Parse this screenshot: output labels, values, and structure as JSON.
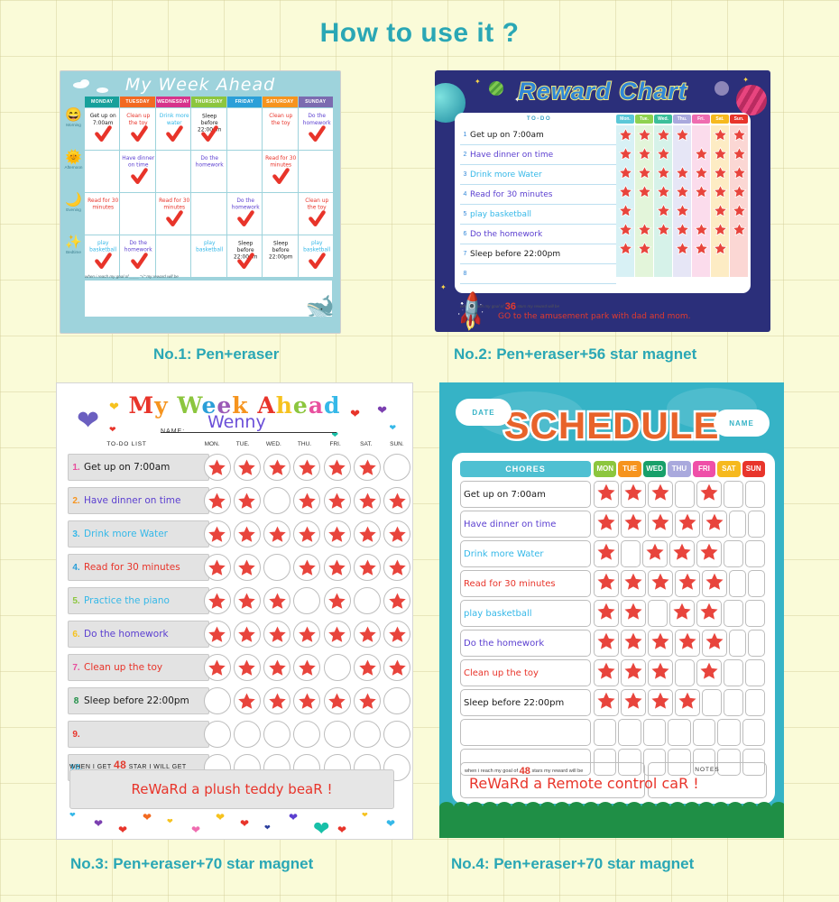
{
  "page": {
    "title": "How to use it ?",
    "title_color": "#2aa7b5",
    "bg_color": "#fafbd8"
  },
  "captions": {
    "no1": "No.1: Pen+eraser",
    "no2": "No.2: Pen+eraser+56 star magnet",
    "no3": "No.3: Pen+eraser+70 star magnet",
    "no4": "No.4: Pen+eraser+70 star magnet"
  },
  "panel1": {
    "title": "My Week Ahead",
    "days": [
      {
        "label": "MONDAY",
        "color": "#17a09b"
      },
      {
        "label": "TUESDAY",
        "color": "#f26a21"
      },
      {
        "label": "WEDNESDAY",
        "color": "#d6338b"
      },
      {
        "label": "THURSDAY",
        "color": "#8cc63e"
      },
      {
        "label": "FRIDAY",
        "color": "#2b9fd8"
      },
      {
        "label": "SATURDAY",
        "color": "#f6941e"
      },
      {
        "label": "SUNDAY",
        "color": "#7b6bb0"
      }
    ],
    "rows": [
      {
        "label": "Morning",
        "icon": "sun-face-icon"
      },
      {
        "label": "Afternoon",
        "icon": "sun-icon"
      },
      {
        "label": "Evening",
        "icon": "moon-icon"
      },
      {
        "label": "Bedtime",
        "icon": "stars-icon"
      }
    ],
    "cells": [
      [
        {
          "text": "Get up on 7:00am",
          "color": "#1a1a1a",
          "check": true
        },
        {
          "text": "Clean up the toy",
          "color": "#e8342a",
          "check": true
        },
        {
          "text": "Drink more water",
          "color": "#35b8e8",
          "check": true
        },
        {
          "text": "Sleep before 22:00pm",
          "color": "#1a1a1a",
          "check": true
        },
        {
          "text": "",
          "color": "#1a1a1a",
          "check": false
        },
        {
          "text": "Clean up the toy",
          "color": "#e8342a",
          "check": false
        },
        {
          "text": "Do the homework",
          "color": "#5b3fd0",
          "check": true
        }
      ],
      [
        {
          "text": "",
          "color": "#1a1a1a",
          "check": false
        },
        {
          "text": "Have dinner on time",
          "color": "#5b3fd0",
          "check": true
        },
        {
          "text": "",
          "color": "#1a1a1a",
          "check": false
        },
        {
          "text": "Do the homework",
          "color": "#5b3fd0",
          "check": false
        },
        {
          "text": "",
          "color": "#1a1a1a",
          "check": false
        },
        {
          "text": "Read for 30 minutes",
          "color": "#e8342a",
          "check": true
        },
        {
          "text": "",
          "color": "#1a1a1a",
          "check": false
        }
      ],
      [
        {
          "text": "Read for 30 minutes",
          "color": "#e8342a",
          "check": false
        },
        {
          "text": "",
          "color": "#1a1a1a",
          "check": false
        },
        {
          "text": "Read for 30 minutes",
          "color": "#e8342a",
          "check": true
        },
        {
          "text": "",
          "color": "#1a1a1a",
          "check": false
        },
        {
          "text": "Do the homework",
          "color": "#5b3fd0",
          "check": true
        },
        {
          "text": "",
          "color": "#1a1a1a",
          "check": false
        },
        {
          "text": "Clean up the toy",
          "color": "#e8342a",
          "check": true
        }
      ],
      [
        {
          "text": "play basketball",
          "color": "#35b8e8",
          "check": true
        },
        {
          "text": "Do the homework",
          "color": "#5b3fd0",
          "check": true
        },
        {
          "text": "",
          "color": "#1a1a1a",
          "check": false
        },
        {
          "text": "play basketball",
          "color": "#35b8e8",
          "check": false
        },
        {
          "text": "Sleep before 22:00pm",
          "color": "#1a1a1a",
          "check": true
        },
        {
          "text": "Sleep before 22:00pm",
          "color": "#1a1a1a",
          "check": false
        },
        {
          "text": "play basketball",
          "color": "#35b8e8",
          "check": true
        }
      ]
    ],
    "footer_note": "when i reach my goal of ____ \"√\" my reward will be"
  },
  "panel2": {
    "title": "Reward Chart",
    "todo_header": "TO-DO",
    "days": [
      {
        "label": "Mon.",
        "head": "#5bc8d8",
        "tint": "#d8f1f5"
      },
      {
        "label": "Tue.",
        "head": "#8ed14f",
        "tint": "#e3f5da"
      },
      {
        "label": "Wed.",
        "head": "#3bbf9a",
        "tint": "#d6f2e9"
      },
      {
        "label": "Thu.",
        "head": "#a9a9dd",
        "tint": "#e6e6f6"
      },
      {
        "label": "Fri.",
        "head": "#ef6cb0",
        "tint": "#fbdcec"
      },
      {
        "label": "Sat.",
        "head": "#f6b91e",
        "tint": "#fdecc4"
      },
      {
        "label": "Sun.",
        "head": "#e8352b",
        "tint": "#fbd7d4"
      }
    ],
    "tasks": [
      {
        "no": "1",
        "text": "Get up on 7:00am",
        "color": "#1a1a1a",
        "stars": [
          1,
          1,
          1,
          1,
          0,
          1,
          1
        ]
      },
      {
        "no": "2",
        "text": "Have dinner on time",
        "color": "#5b3fd0",
        "stars": [
          1,
          1,
          1,
          0,
          1,
          1,
          1
        ]
      },
      {
        "no": "3",
        "text": "Drink more Water",
        "color": "#35b8e8",
        "stars": [
          1,
          1,
          1,
          1,
          1,
          1,
          1
        ]
      },
      {
        "no": "4",
        "text": "Read for 30 minutes",
        "color": "#5b3fd0",
        "stars": [
          1,
          1,
          1,
          1,
          1,
          1,
          1
        ]
      },
      {
        "no": "5",
        "text": "play basketball",
        "color": "#35b8e8",
        "stars": [
          1,
          0,
          1,
          1,
          0,
          1,
          1
        ]
      },
      {
        "no": "6",
        "text": "Do the homework",
        "color": "#5b3fd0",
        "stars": [
          1,
          1,
          1,
          1,
          1,
          1,
          1
        ]
      },
      {
        "no": "7",
        "text": "Sleep before 22:00pm",
        "color": "#1a1a1a",
        "stars": [
          1,
          1,
          0,
          1,
          1,
          1,
          0
        ]
      },
      {
        "no": "8",
        "text": "",
        "color": "#1a1a1a",
        "stars": [
          0,
          0,
          0,
          0,
          0,
          0,
          0
        ]
      }
    ],
    "goal_prefix": "when i reach my goal of",
    "goal_number": "36",
    "goal_suffix": "stars my reward will be",
    "reward_text": "GO to the amusement park with dad and mom."
  },
  "panel3": {
    "title": "My Week Ahead",
    "title_letters": [
      {
        "ch": "M",
        "color": "#e8342a"
      },
      {
        "ch": "y",
        "color": "#f6941e"
      },
      {
        "ch": " ",
        "color": "#000000"
      },
      {
        "ch": "W",
        "color": "#8cc63e"
      },
      {
        "ch": "e",
        "color": "#2b9fd8"
      },
      {
        "ch": "e",
        "color": "#9b59b6"
      },
      {
        "ch": "k",
        "color": "#f6941e"
      },
      {
        "ch": " ",
        "color": "#000000"
      },
      {
        "ch": "A",
        "color": "#e8342a"
      },
      {
        "ch": "h",
        "color": "#f6c21e"
      },
      {
        "ch": "e",
        "color": "#8cc63e"
      },
      {
        "ch": "a",
        "color": "#e84f9e"
      },
      {
        "ch": "d",
        "color": "#35b8e8"
      }
    ],
    "name_label": "NAME:",
    "name_value": "Wenny",
    "todo_header": "TO-DO LIST",
    "days": [
      "MON.",
      "TUE.",
      "WED.",
      "THU.",
      "FRI.",
      "SAT.",
      "SUN."
    ],
    "rows": [
      {
        "no": "1.",
        "text": "Get up on 7:00am",
        "no_color": "#e84f9e",
        "text_color": "#1a1a1a",
        "stars": [
          1,
          1,
          1,
          1,
          1,
          1,
          0
        ]
      },
      {
        "no": "2.",
        "text": "Have dinner on time",
        "no_color": "#f6941e",
        "text_color": "#5b3fd0",
        "stars": [
          1,
          1,
          0,
          1,
          1,
          1,
          1
        ]
      },
      {
        "no": "3.",
        "text": "Drink more Water",
        "no_color": "#35b8e8",
        "text_color": "#35b8e8",
        "stars": [
          1,
          1,
          1,
          1,
          1,
          1,
          1
        ]
      },
      {
        "no": "4.",
        "text": "Read for 30 minutes",
        "no_color": "#2b9fd8",
        "text_color": "#e8342a",
        "stars": [
          1,
          1,
          0,
          1,
          1,
          1,
          1
        ]
      },
      {
        "no": "5.",
        "text": "Practice the piano",
        "no_color": "#8cc63e",
        "text_color": "#35b8e8",
        "stars": [
          1,
          1,
          1,
          0,
          1,
          0,
          1
        ]
      },
      {
        "no": "6.",
        "text": "Do the homework",
        "no_color": "#f6c21e",
        "text_color": "#5b3fd0",
        "stars": [
          1,
          1,
          1,
          1,
          1,
          1,
          1
        ]
      },
      {
        "no": "7.",
        "text": "Clean up the toy",
        "no_color": "#e84f9e",
        "text_color": "#e8342a",
        "stars": [
          1,
          1,
          1,
          1,
          0,
          1,
          1
        ]
      },
      {
        "no": "8",
        "text": "Sleep before 22:00pm",
        "no_color": "#1f8f46",
        "text_color": "#1a1a1a",
        "stars": [
          0,
          1,
          1,
          1,
          1,
          1,
          0
        ]
      },
      {
        "no": "9.",
        "text": "",
        "no_color": "#e8342a",
        "text_color": "#1a1a1a",
        "stars": [
          0,
          0,
          0,
          0,
          0,
          0,
          0
        ]
      },
      {
        "no": "10.",
        "text": "",
        "no_color": "#35b8e8",
        "text_color": "#1a1a1a",
        "stars": [
          0,
          0,
          0,
          0,
          0,
          0,
          0
        ]
      }
    ],
    "footer_prefix": "WHEN I GET",
    "footer_number": "48",
    "footer_suffix": "STAR I WILL GET",
    "reward_text": "ReWaRd a plush teddy beaR !"
  },
  "panel4": {
    "title": "SCHEDULE",
    "date_label": "DATE",
    "name_label": "NAME",
    "chores_header": "CHORES",
    "days": [
      {
        "label": "MON",
        "color": "#8cc63e"
      },
      {
        "label": "TUE",
        "color": "#f6941e"
      },
      {
        "label": "WED",
        "color": "#18a06a"
      },
      {
        "label": "THU",
        "color": "#a9a9dd"
      },
      {
        "label": "FRI",
        "color": "#ef4fa8"
      },
      {
        "label": "SAT",
        "color": "#f6b91e"
      },
      {
        "label": "SUN",
        "color": "#e8352b"
      }
    ],
    "rows": [
      {
        "text": "Get up on 7:00am",
        "color": "#1a1a1a",
        "stars": [
          1,
          1,
          1,
          0,
          1,
          0,
          0
        ]
      },
      {
        "text": "Have dinner on time",
        "color": "#5b3fd0",
        "stars": [
          1,
          1,
          1,
          1,
          1,
          0,
          0
        ]
      },
      {
        "text": "Drink more Water",
        "color": "#35b8e8",
        "stars": [
          1,
          0,
          1,
          1,
          1,
          0,
          0
        ]
      },
      {
        "text": "Read for 30 minutes",
        "color": "#e8342a",
        "stars": [
          1,
          1,
          1,
          1,
          1,
          0,
          0
        ]
      },
      {
        "text": "play basketball",
        "color": "#35b8e8",
        "stars": [
          1,
          1,
          0,
          1,
          1,
          0,
          0
        ]
      },
      {
        "text": "Do the homework",
        "color": "#5b3fd0",
        "stars": [
          1,
          1,
          1,
          1,
          1,
          0,
          0
        ]
      },
      {
        "text": "Clean up the toy",
        "color": "#e8342a",
        "stars": [
          1,
          1,
          1,
          0,
          1,
          0,
          0
        ]
      },
      {
        "text": "Sleep before 22:00pm",
        "color": "#1a1a1a",
        "stars": [
          1,
          1,
          1,
          1,
          0,
          0,
          0
        ]
      },
      {
        "text": "",
        "color": "#1a1a1a",
        "stars": [
          0,
          0,
          0,
          0,
          0,
          0,
          0
        ]
      },
      {
        "text": "",
        "color": "#1a1a1a",
        "stars": [
          0,
          0,
          0,
          0,
          0,
          0,
          0
        ]
      }
    ],
    "goal_prefix": "when i reach my goal of",
    "goal_number": "48",
    "goal_suffix": "stars my reward will be",
    "notes_label": "NOTES",
    "reward_text": "ReWaRd a Remote control caR !"
  },
  "colors": {
    "star_red": "#e8443c",
    "accent_teal": "#2aa7b5"
  }
}
